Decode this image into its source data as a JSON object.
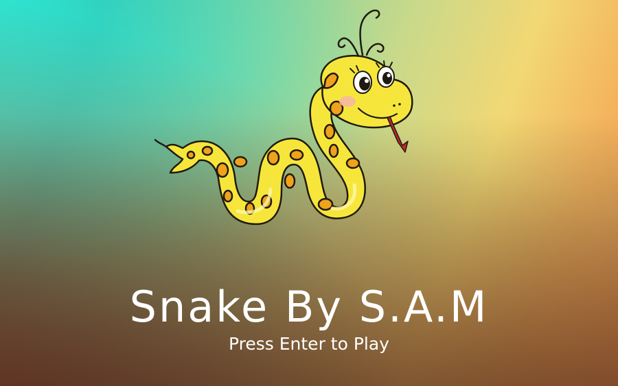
{
  "game": {
    "title": "Snake By S.A.M",
    "prompt": "Press Enter to Play"
  },
  "mascot": {
    "icon": "cartoon-snake-icon",
    "body_color": "#f6e63c",
    "spot_color": "#f0a21c",
    "tongue_color": "#c0272d"
  },
  "colors": {
    "text": "#ffffff",
    "bg_teal": "#2fe6cf",
    "bg_yellow": "#f2d874",
    "bg_orange": "#e0622a"
  }
}
